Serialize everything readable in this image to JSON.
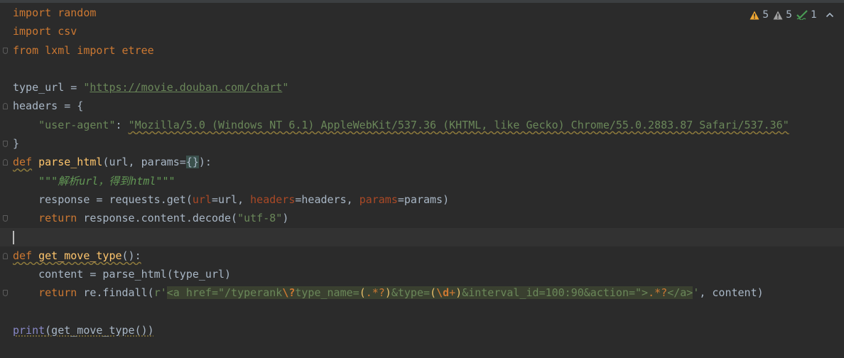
{
  "code": {
    "l1": "import random",
    "l2": "import csv",
    "l3": "from lxml import etree",
    "l5_var": "type_url",
    "l5_eq": " = ",
    "l5_q1": "\"",
    "l5_url": "https://movie.douban.com/chart",
    "l5_q2": "\"",
    "l6": "headers = {",
    "l7_indent": "    ",
    "l7_key": "\"user-agent\"",
    "l7_colon": ": ",
    "l7_val": "\"Mozilla/5.0 (Windows NT 6.1) AppleWebKit/537.36 (KHTML, like Gecko) Chrome/55.0.2883.87 Safari/537.36\"",
    "l8": "}",
    "l9_def": "def",
    "l9_sp": " ",
    "l9_name": "parse_html",
    "l9_open": "(url, params=",
    "l9_brace": "{}",
    "l9_close": "):",
    "l10_indent": "    ",
    "l10_doc": "\"\"\"解析url，得到html\"\"\"",
    "l11_a": "    response = requests.get(",
    "l11_p1": "url",
    "l11_b": "=url, ",
    "l11_p2": "headers",
    "l11_c": "=headers, ",
    "l11_p3": "params",
    "l11_d": "=params)",
    "l12_indent": "    ",
    "l12_ret": "return",
    "l12_a": " response.content.decode(",
    "l12_str": "\"utf-8\"",
    "l12_b": ")",
    "l14_def": "def",
    "l14_sp": " ",
    "l14_name": "get_move_type",
    "l14_rest": "():",
    "l15": "    content = parse_html(type_url)",
    "l16_indent": "    ",
    "l16_ret": "return",
    "l16_a": " re.findall(",
    "l16_r": "r'",
    "l16_rx1": "<a href=\"/typerank",
    "l16_rx2": "\\?",
    "l16_rx3": "type_name=",
    "l16_rx4": "(",
    "l16_rx5": ".*?",
    "l16_rx6": ")",
    "l16_rx7": "&type=",
    "l16_rx8": "(",
    "l16_rx9": "\\d",
    "l16_rx10": "+",
    "l16_rx11": ")",
    "l16_rx12": "&interval_id=100:90&action=\">",
    "l16_rx13": ".*?",
    "l16_rx14": "</a>",
    "l16_q": "'",
    "l16_tail": ", content)",
    "l18_print": "print",
    "l18_rest": "(get_move_type())"
  },
  "inspections": {
    "warnings": "5",
    "weak_warnings": "5",
    "typos": "1"
  },
  "colors": {
    "background": "#2b2b2b",
    "keyword": "#cc7832",
    "function": "#ffc66d",
    "string": "#6a8759",
    "text": "#a9b7c6",
    "warning": "#f0a732"
  },
  "icons": [
    "warning-icon",
    "weak-warning-icon",
    "typo-check-icon",
    "chevron-up-icon",
    "fold-marker-icon"
  ]
}
